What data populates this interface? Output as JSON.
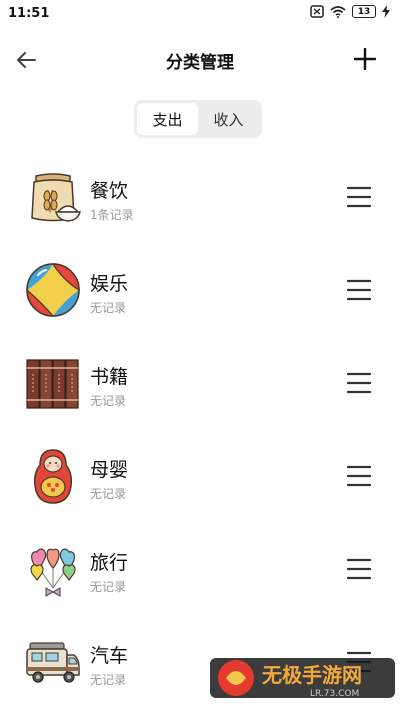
{
  "status_bar": {
    "time": "11:51",
    "battery": "13"
  },
  "header": {
    "title": "分类管理"
  },
  "tabs": [
    {
      "label": "支出"
    },
    {
      "label": "收入"
    }
  ],
  "categories": [
    {
      "name": "餐饮",
      "count": "1条记录",
      "icon": "rice-bag-icon"
    },
    {
      "name": "娱乐",
      "count": "无记录",
      "icon": "beach-ball-icon"
    },
    {
      "name": "书籍",
      "count": "无记录",
      "icon": "books-icon"
    },
    {
      "name": "母婴",
      "count": "无记录",
      "icon": "matryoshka-doll-icon"
    },
    {
      "name": "旅行",
      "count": "无记录",
      "icon": "heart-balloons-icon"
    },
    {
      "name": "汽车",
      "count": "无记录",
      "icon": "camper-van-icon"
    }
  ],
  "watermark": {
    "text": "无极手游网",
    "sub": "LR.73.COM"
  }
}
